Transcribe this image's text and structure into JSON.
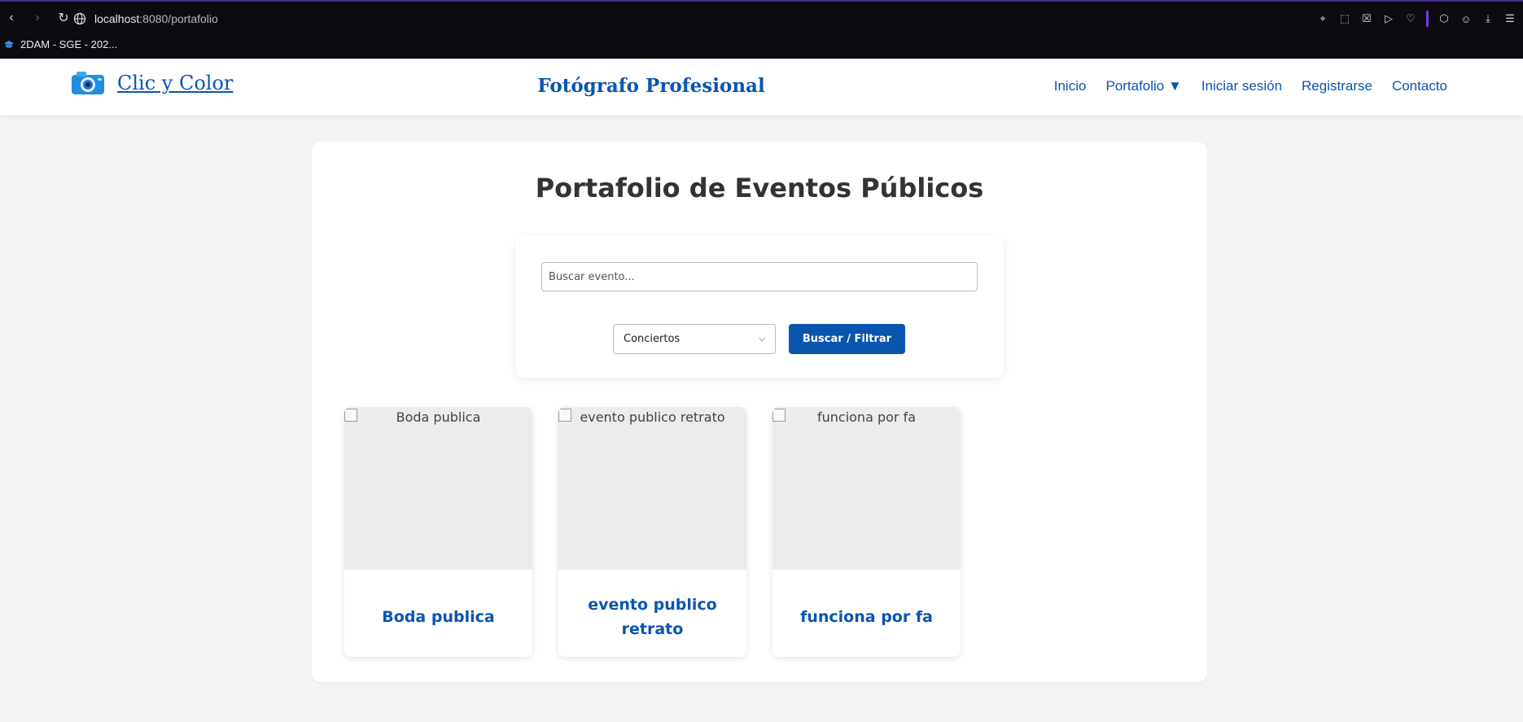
{
  "browser": {
    "url_host": "localhost",
    "url_path": ":8080/portafolio",
    "bookmark_label": "2DAM - SGE - 202..."
  },
  "site": {
    "brand": "Clic y Color",
    "tagline": "Fotógrafo Profesional",
    "nav": [
      "Inicio",
      "Portafolio ▼",
      "Iniciar sesión",
      "Registrarse",
      "Contacto"
    ]
  },
  "page": {
    "title": "Portafolio de Eventos Públicos",
    "search_placeholder": "Buscar evento...",
    "category_selected": "Conciertos",
    "filter_button": "Buscar / Filtrar"
  },
  "cards": [
    {
      "alt": "Boda publica",
      "title": "Boda publica"
    },
    {
      "alt": "evento publico retrato",
      "title": "evento publico retrato"
    },
    {
      "alt": "funciona por fa",
      "title": "funciona por fa"
    }
  ],
  "colors": {
    "accent": "#0a55b0",
    "page_bg": "#f4f4f4",
    "browser_bg": "#0b0b0f"
  }
}
